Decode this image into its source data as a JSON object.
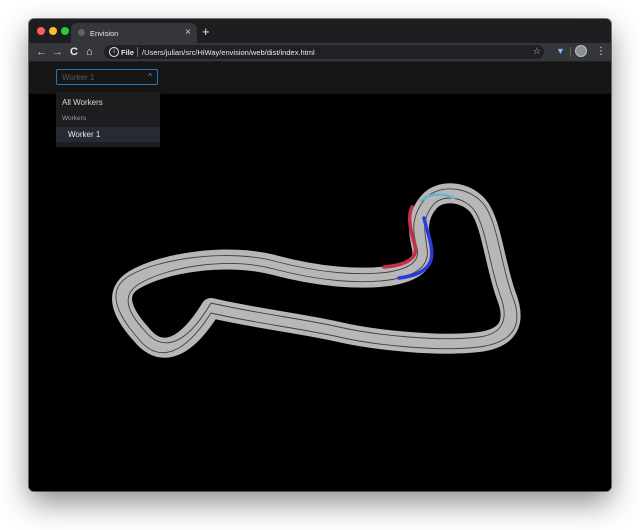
{
  "browser": {
    "tab_title": "Envision",
    "tab_close": "×",
    "new_tab": "+",
    "back": "←",
    "forward": "→",
    "reload": "C",
    "home": "⌂",
    "url_scheme": "File",
    "url": "/Users/julian/src/HiWay/envision/web/dist/index.html",
    "info_glyph": "i",
    "bookmark": "☆",
    "extension_glyph": "▼",
    "menu": "⋮"
  },
  "worker_select": {
    "value": "Worker 1",
    "chevron": "^",
    "options": {
      "all": "All Workers",
      "group_label": "Workers",
      "worker_1": "Worker 1"
    }
  },
  "track": {
    "surface_color": "#b7b7b7",
    "lane_line_color": "#404040",
    "vehicles": {
      "red": "#c0304a",
      "blue": "#2a3adb",
      "cyan": "#63b8d0"
    }
  }
}
